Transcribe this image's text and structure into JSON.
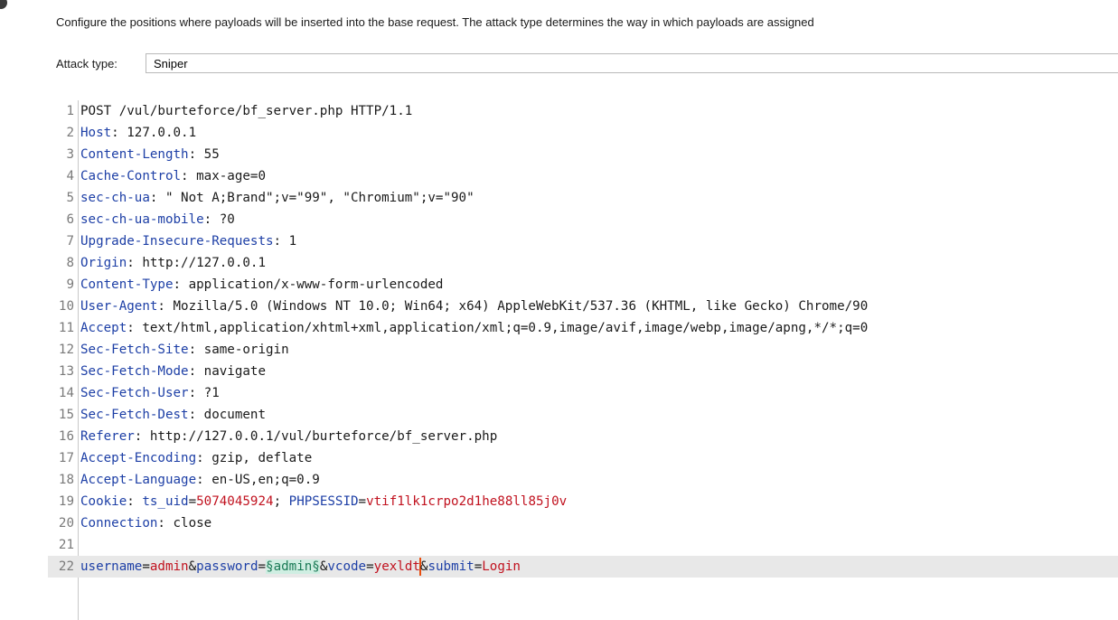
{
  "header": {
    "description": "Configure the positions where payloads will be inserted into the base request. The attack type determines the way in which payloads are assigned",
    "attack_type_label": "Attack type:",
    "attack_type_value": "Sniper"
  },
  "request": {
    "lines": [
      {
        "n": "1",
        "plain": "POST /vul/burteforce/bf_server.php HTTP/1.1"
      },
      {
        "n": "2",
        "name": "Host",
        "value": " 127.0.0.1"
      },
      {
        "n": "3",
        "name": "Content-Length",
        "value": " 55"
      },
      {
        "n": "4",
        "name": "Cache-Control",
        "value": " max-age=0"
      },
      {
        "n": "5",
        "name": "sec-ch-ua",
        "value": " \" Not A;Brand\";v=\"99\", \"Chromium\";v=\"90\""
      },
      {
        "n": "6",
        "name": "sec-ch-ua-mobile",
        "value": " ?0"
      },
      {
        "n": "7",
        "name": "Upgrade-Insecure-Requests",
        "value": " 1"
      },
      {
        "n": "8",
        "name": "Origin",
        "value": " http://127.0.0.1"
      },
      {
        "n": "9",
        "name": "Content-Type",
        "value": " application/x-www-form-urlencoded"
      },
      {
        "n": "10",
        "name": "User-Agent",
        "value": " Mozilla/5.0 (Windows NT 10.0; Win64; x64) AppleWebKit/537.36 (KHTML, like Gecko) Chrome/90"
      },
      {
        "n": "11",
        "name": "Accept",
        "value": " text/html,application/xhtml+xml,application/xml;q=0.9,image/avif,image/webp,image/apng,*/*;q=0"
      },
      {
        "n": "12",
        "name": "Sec-Fetch-Site",
        "value": " same-origin"
      },
      {
        "n": "13",
        "name": "Sec-Fetch-Mode",
        "value": " navigate"
      },
      {
        "n": "14",
        "name": "Sec-Fetch-User",
        "value": " ?1"
      },
      {
        "n": "15",
        "name": "Sec-Fetch-Dest",
        "value": " document"
      },
      {
        "n": "16",
        "name": "Referer",
        "value": " http://127.0.0.1/vul/burteforce/bf_server.php"
      },
      {
        "n": "17",
        "name": "Accept-Encoding",
        "value": " gzip, deflate"
      },
      {
        "n": "18",
        "name": "Accept-Language",
        "value": " en-US,en;q=0.9"
      },
      {
        "n": "19",
        "name": "Cookie",
        "cookie": true
      },
      {
        "n": "20",
        "name": "Connection",
        "value": " close"
      },
      {
        "n": "21",
        "blank": true
      },
      {
        "n": "22",
        "body": true
      }
    ],
    "cookie": {
      "k1": "ts_uid",
      "v1": "5074045924",
      "sep": "; ",
      "k2": "PHPSESSID",
      "v2": "vtif1lk1crpo2d1he88ll85j0v"
    },
    "body": {
      "k1": "username",
      "v1": "admin",
      "k2": "password",
      "marker": "§admin§",
      "k3": "vcode",
      "v3": "yexldt",
      "k4": "submit",
      "v4": "Login"
    }
  }
}
